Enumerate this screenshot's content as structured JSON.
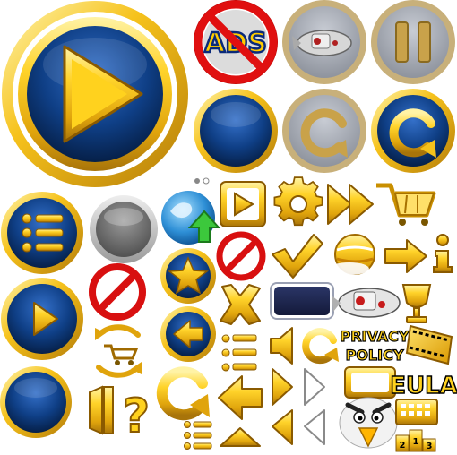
{
  "sheet": {
    "badge_ads": "ADS",
    "privacy_line1": "PRIVACY",
    "privacy_line2": "POLICY",
    "eula": "EULA",
    "help_glyph": "?",
    "podium_1": "1",
    "podium_2": "2",
    "podium_3": "3",
    "colors": {
      "navy": "#0f3f86",
      "navy_dark": "#06234f",
      "gold": "#f5c21b",
      "gold_dark": "#b8860b",
      "gold_light": "#ffe97a",
      "red": "#e01010",
      "gray": "#7b7b7b",
      "disabled_ring": "#b8b8b8"
    }
  }
}
